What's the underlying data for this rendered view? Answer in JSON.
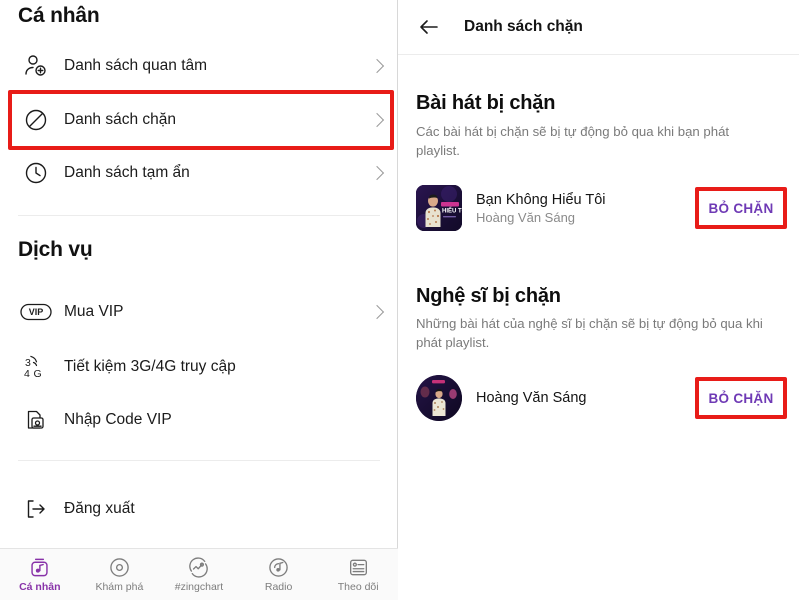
{
  "colors": {
    "accent_purple": "#8832a8",
    "unblock_text": "#6f3ab5",
    "annotation_red": "#e81c18",
    "text_primary": "#141414",
    "text_secondary": "#7a7a7a",
    "divider": "#ececec"
  },
  "left_panel": {
    "personal_section": {
      "title": "Cá nhân",
      "items": [
        {
          "label": "Danh sách quan tâm",
          "icon": "person-add-icon",
          "chevron": true
        },
        {
          "label": "Danh sách chặn",
          "icon": "block-circle-icon",
          "chevron": true
        },
        {
          "label": "Danh sách tạm ẩn",
          "icon": "clock-icon",
          "chevron": true
        }
      ]
    },
    "services_section": {
      "title": "Dịch vụ",
      "items": [
        {
          "label": "Mua VIP",
          "icon": "vip-badge-icon",
          "chevron": true
        },
        {
          "label": "Tiết kiệm 3G/4G truy cập",
          "icon": "data-saver-3g4g-icon",
          "chevron": false
        },
        {
          "label": "Nhập Code VIP",
          "icon": "code-document-icon",
          "chevron": false
        }
      ]
    },
    "logout": {
      "label": "Đăng xuất",
      "icon": "logout-arrow-icon"
    },
    "bottom_nav": [
      {
        "label": "Cá nhân",
        "icon": "personal-music-icon",
        "active": true
      },
      {
        "label": "Khám phá",
        "icon": "disc-explore-icon",
        "active": false
      },
      {
        "label": "#zingchart",
        "icon": "chart-trend-icon",
        "active": false
      },
      {
        "label": "Radio",
        "icon": "radio-waves-icon",
        "active": false
      },
      {
        "label": "Theo dõi",
        "icon": "following-list-icon",
        "active": false
      }
    ]
  },
  "right_panel": {
    "topbar": {
      "title": "Danh sách chặn",
      "back_icon": "back-arrow-icon"
    },
    "blocked_songs": {
      "heading": "Bài hát bị chặn",
      "description": "Các bài hát bị chặn sẽ bị tự động bỏ qua khi bạn phát playlist.",
      "items": [
        {
          "title": "Bạn Không Hiểu Tôi",
          "artist": "Hoàng Văn Sáng",
          "action_label": "BỎ CHẶN",
          "thumbnail": "album-art-ban-khong-hieu-toi"
        }
      ]
    },
    "blocked_artists": {
      "heading": "Nghệ sĩ bị chặn",
      "description": "Những bài hát của nghệ sĩ bị chặn sẽ bị tự động bỏ qua khi phát playlist.",
      "items": [
        {
          "name": "Hoàng Văn Sáng",
          "action_label": "BỎ CHẶN",
          "avatar": "artist-avatar-hoang-van-sang"
        }
      ]
    }
  },
  "annotations": [
    {
      "name": "highlight-blocked-list-row"
    },
    {
      "name": "highlight-unblock-song-button"
    },
    {
      "name": "highlight-unblock-artist-button"
    }
  ]
}
